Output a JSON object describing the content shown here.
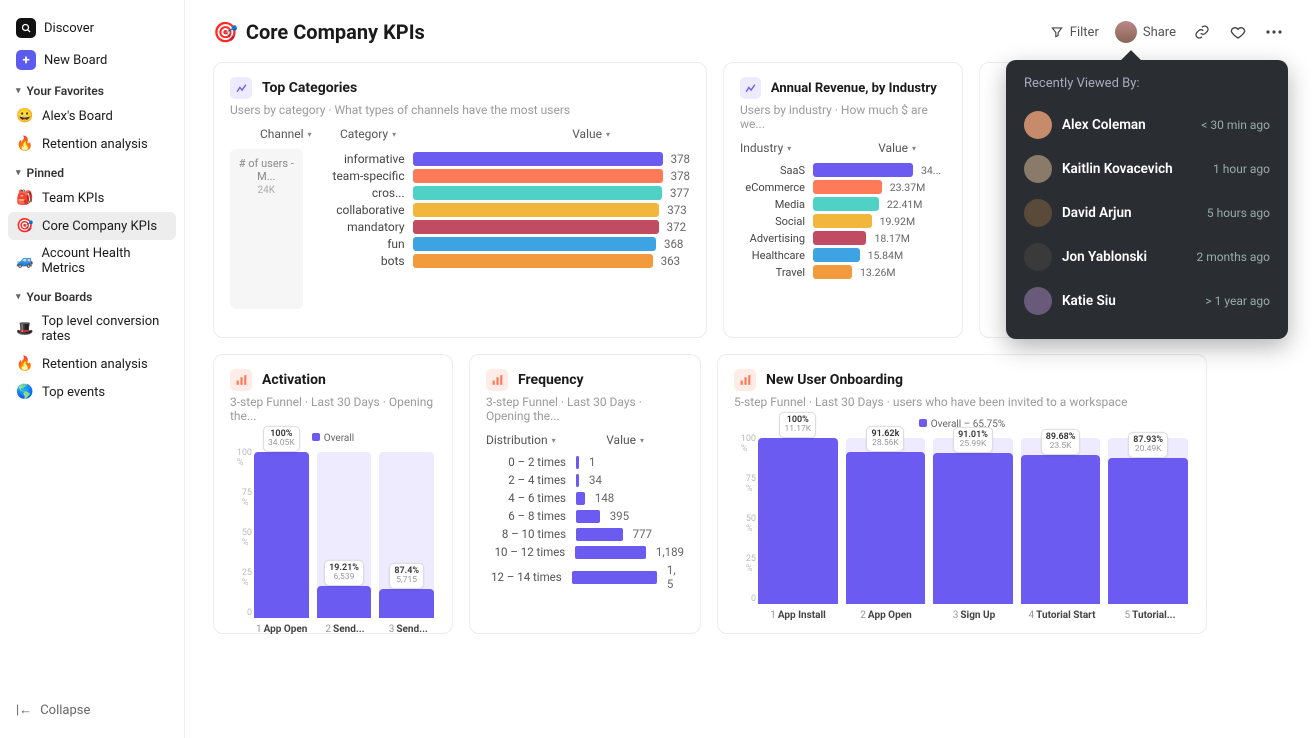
{
  "sidebar": {
    "discover": "Discover",
    "new_board": "New Board",
    "favorites_header": "Your Favorites",
    "favorites": [
      {
        "emoji": "😀",
        "label": "Alex's Board"
      },
      {
        "emoji": "🔥",
        "label": "Retention analysis"
      }
    ],
    "pinned_header": "Pinned",
    "pinned": [
      {
        "emoji": "🎒",
        "label": "Team KPIs"
      },
      {
        "emoji": "🎯",
        "label": "Core Company KPIs",
        "active": true
      },
      {
        "emoji": "🚙",
        "label": "Account Health Metrics"
      }
    ],
    "boards_header": "Your Boards",
    "boards": [
      {
        "emoji": "🎩",
        "label": "Top level conversion rates"
      },
      {
        "emoji": "🔥",
        "label": "Retention analysis"
      },
      {
        "emoji": "🌎",
        "label": "Top events"
      }
    ],
    "collapse": "Collapse"
  },
  "header": {
    "title_emoji": "🎯",
    "title": "Core Company KPIs",
    "filter": "Filter",
    "share": "Share"
  },
  "top_categories": {
    "title": "Top Categories",
    "subtitle": "Users by category · What types of channels have the most users",
    "cols": {
      "channel": "Channel",
      "category": "Category",
      "value": "Value"
    },
    "sidebox_label": "# of users - M...",
    "sidebox_value": "24K"
  },
  "annual_revenue": {
    "title": "Annual Revenue, by Industry",
    "subtitle": "Users by industry · How much $ are we...",
    "cols": {
      "industry": "Industry",
      "value": "Value"
    }
  },
  "activation": {
    "title": "Activation",
    "subtitle": "3-step Funnel · Last 30 Days · Opening the...",
    "legend": "Overall"
  },
  "frequency": {
    "title": "Frequency",
    "subtitle": "3-step Funnel · Last 30 Days · Opening the...",
    "cols": {
      "distribution": "Distribution",
      "value": "Value"
    }
  },
  "onboarding": {
    "title": "New User Onboarding",
    "subtitle": "5-step Funnel · Last 30 Days · users who have been invited to a workspace",
    "legend": "Overall – 65.75%"
  },
  "popover": {
    "title": "Recently Viewed By:",
    "rows": [
      {
        "name": "Alex Coleman",
        "time": "< 30 min ago",
        "color": "#c58b6a"
      },
      {
        "name": "Kaitlin Kovacevich",
        "time": "1 hour ago",
        "color": "#8a7a6a"
      },
      {
        "name": "David Arjun",
        "time": "5 hours ago",
        "color": "#5a4a3a"
      },
      {
        "name": "Jon Yablonski",
        "time": "2 months ago",
        "color": "#3a3a3a"
      },
      {
        "name": "Katie Siu",
        "time": "> 1 year ago",
        "color": "#6a5a7a"
      }
    ]
  },
  "chart_data": [
    {
      "id": "top_categories",
      "type": "bar",
      "orientation": "horizontal",
      "categories": [
        "informative",
        "team-specific",
        "cros...",
        "collaborative",
        "mandatory",
        "fun",
        "bots"
      ],
      "values": [
        378,
        378,
        377,
        373,
        372,
        368,
        363
      ],
      "colors": [
        "#6b5bf0",
        "#ff7a59",
        "#4fd1c5",
        "#f2b63c",
        "#c14b63",
        "#3ea3e3",
        "#f29b3c"
      ],
      "xlabel": "",
      "ylabel": "",
      "title": "Top Categories"
    },
    {
      "id": "annual_revenue",
      "type": "bar",
      "orientation": "horizontal",
      "categories": [
        "SaaS",
        "eCommerce",
        "Media",
        "Social",
        "Advertising",
        "Healthcare",
        "Travel"
      ],
      "values_label": [
        "34...",
        "23.37M",
        "22.41M",
        "19.92M",
        "18.17M",
        "15.84M",
        "13.26M"
      ],
      "values": [
        34,
        23.37,
        22.41,
        19.92,
        18.17,
        15.84,
        13.26
      ],
      "colors": [
        "#6b5bf0",
        "#ff7a59",
        "#4fd1c5",
        "#f2b63c",
        "#c14b63",
        "#3ea3e3",
        "#f29b3c"
      ],
      "title": "Annual Revenue, by Industry"
    },
    {
      "id": "activation",
      "type": "bar",
      "categories": [
        "App Open",
        "Send...",
        "Send..."
      ],
      "values_pct": [
        "100%",
        "19.21%",
        "87.4%"
      ],
      "values_label": [
        "34.05K",
        "6,539",
        "5,715"
      ],
      "values": [
        100,
        19.21,
        17.4
      ],
      "ylim": [
        0,
        100
      ],
      "title": "Activation"
    },
    {
      "id": "frequency",
      "type": "bar",
      "orientation": "horizontal",
      "categories": [
        "0 – 2 times",
        "2 – 4 times",
        "4 – 6 times",
        "6 – 8 times",
        "8 – 10 times",
        "10 – 12 times",
        "12 – 14 times"
      ],
      "values": [
        1,
        34,
        148,
        395,
        777,
        1189,
        1500
      ],
      "values_label": [
        "1",
        "34",
        "148",
        "395",
        "777",
        "1,189",
        "1, 5"
      ],
      "title": "Frequency"
    },
    {
      "id": "onboarding",
      "type": "bar",
      "categories": [
        "App Install",
        "App Open",
        "Sign Up",
        "Tutorial Start",
        "Tutorial..."
      ],
      "values_pct": [
        "100%",
        "91.62k",
        "91.01%",
        "89.68%",
        "87.93%"
      ],
      "values_label": [
        "11.17K",
        "28.56K",
        "25.99K",
        "23.5K",
        "20.49K"
      ],
      "values": [
        100,
        91.62,
        91.01,
        89.68,
        87.93
      ],
      "ylim": [
        0,
        100
      ],
      "title": "New User Onboarding"
    }
  ]
}
